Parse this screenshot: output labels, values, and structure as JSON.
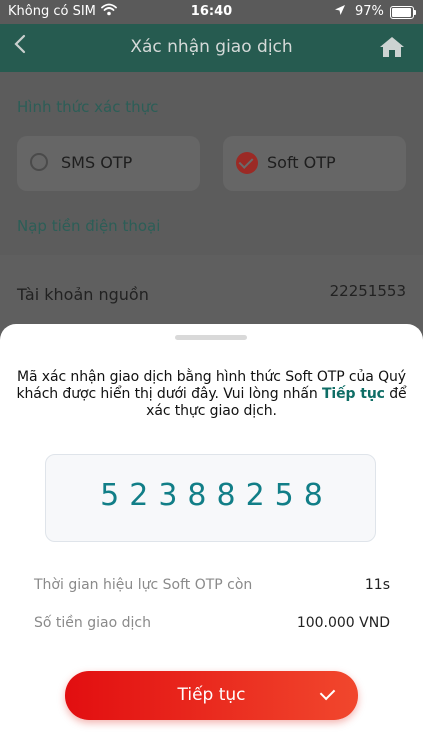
{
  "status_bar": {
    "carrier": "Không có SIM",
    "time": "16:40",
    "battery": "97%"
  },
  "header": {
    "title": "Xác nhận giao dịch"
  },
  "auth_section": {
    "label": "Hình thức xác thực",
    "options": [
      {
        "label": "SMS OTP",
        "selected": false
      },
      {
        "label": "Soft OTP",
        "selected": true
      }
    ]
  },
  "service_label": "Nạp tiền điện thoại",
  "source_account": {
    "label": "Tài khoản nguồn",
    "value": "22251553"
  },
  "sheet": {
    "message_before": "Mã xác nhận giao dịch bằng hình thức Soft OTP của Quý khách được hiển thị dưới đây. Vui lòng nhấn ",
    "message_link": "Tiếp tục",
    "message_after": " để xác thực giao dịch.",
    "otp_code": "52388258",
    "validity": {
      "label": "Thời gian hiệu lực Soft OTP còn",
      "value": "11s"
    },
    "amount": {
      "label": "Số tiền giao dịch",
      "value": "100.000 VND"
    },
    "continue_label": "Tiếp tục"
  },
  "colors": {
    "accent": "#117e87",
    "cta": "#e20e10",
    "header": "#265b50"
  }
}
